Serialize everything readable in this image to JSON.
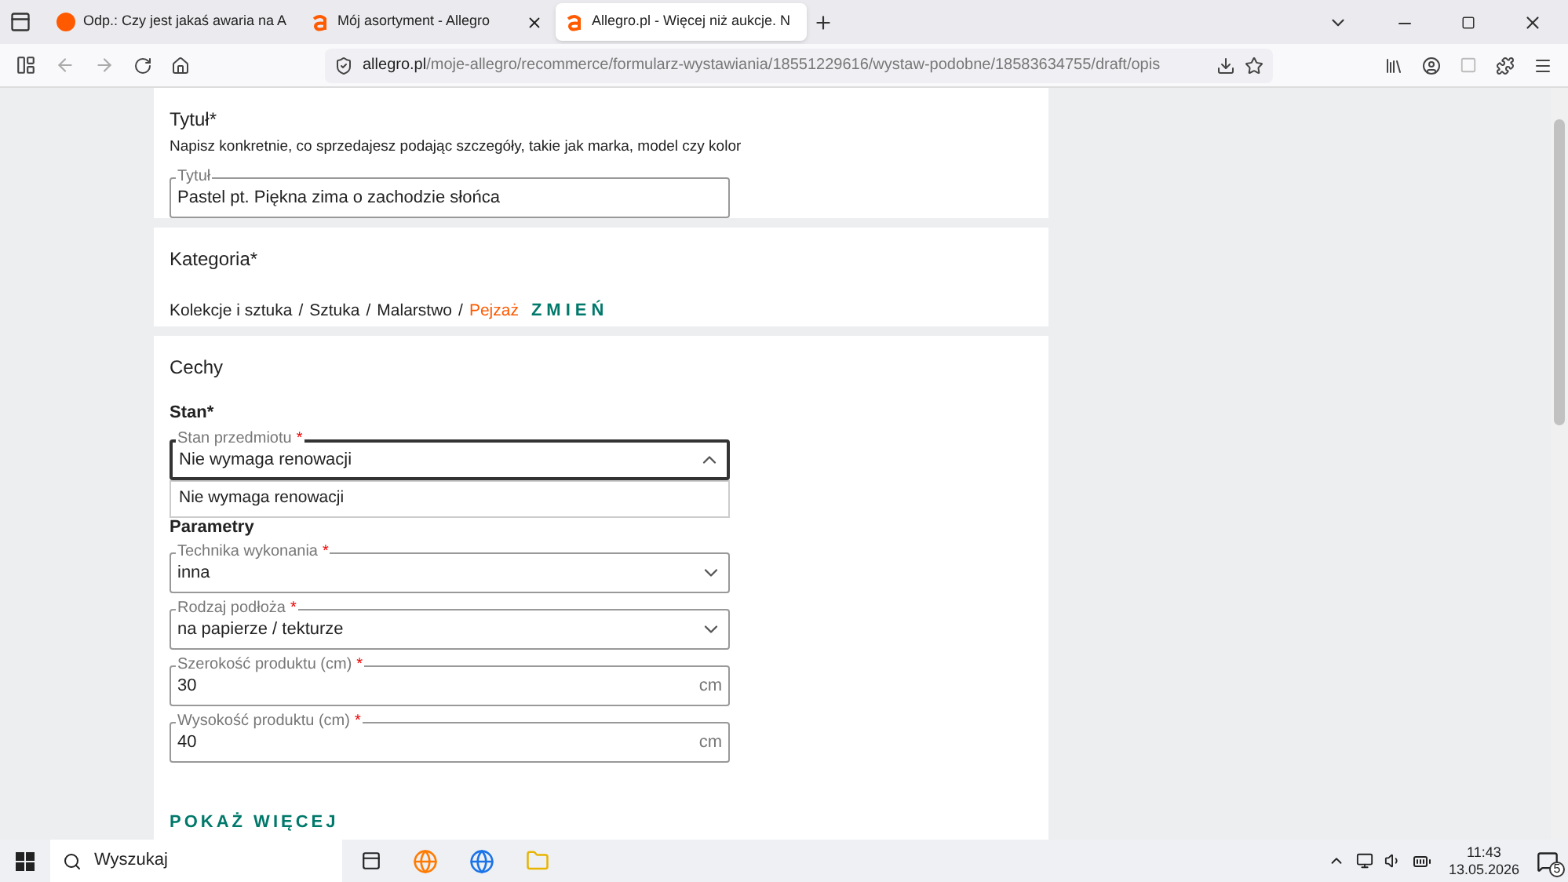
{
  "browser": {
    "tabs": [
      {
        "title": "Odp.: Czy jest jakaś awaria na A",
        "selected": false
      },
      {
        "title": "Mój asortyment - Allegro",
        "selected": false
      },
      {
        "title": "Allegro.pl - Więcej niż aukcje. N",
        "selected": true
      }
    ],
    "url_host": "allegro.pl",
    "url_path": "/moje-allegro/recommerce/formularz-wystawiania/18551229616/wystaw-podobne/18583634755/draft/opis"
  },
  "title_section": {
    "heading": "Tytuł*",
    "hint": "Napisz konkretnie, co sprzedajesz podając szczegóły, takie jak marka, model czy kolor",
    "field": {
      "label": "Tytuł",
      "value": "Pastel pt. Piękna zima o zachodzie słońca"
    }
  },
  "category_section": {
    "heading": "Kategoria*",
    "path": [
      "Kolekcje i sztuka",
      "Sztuka",
      "Malarstwo"
    ],
    "separator": "/",
    "current": "Pejzaż",
    "change_link": "ZMIEŃ"
  },
  "features_section": {
    "heading": "Cechy",
    "state_heading": "Stan*",
    "state_field": {
      "kind": "select",
      "label": "Stan przedmiotu",
      "required_mark": "*",
      "value": "Nie wymaga renowacji",
      "expanded": true,
      "options": [
        "Nie wymaga renowacji"
      ]
    },
    "params_heading": "Parametry",
    "fields": [
      {
        "kind": "select",
        "label": "Technika wykonania",
        "required_mark": "*",
        "value": "inna"
      },
      {
        "kind": "select",
        "label": "Rodzaj podłoża",
        "required_mark": "*",
        "value": "na papierze / tekturze"
      },
      {
        "kind": "number",
        "label": "Szerokość produktu (cm)",
        "required_mark": "*",
        "value": "30",
        "unit": "cm"
      },
      {
        "kind": "number",
        "label": "Wysokość produktu (cm)",
        "required_mark": "*",
        "value": "40",
        "unit": "cm"
      }
    ],
    "show_more": "POKAŻ WIĘCEJ"
  },
  "taskbar": {
    "search_placeholder": "Wyszukaj",
    "time": "11:43",
    "date": "13.05.2026",
    "notifications": "5"
  }
}
